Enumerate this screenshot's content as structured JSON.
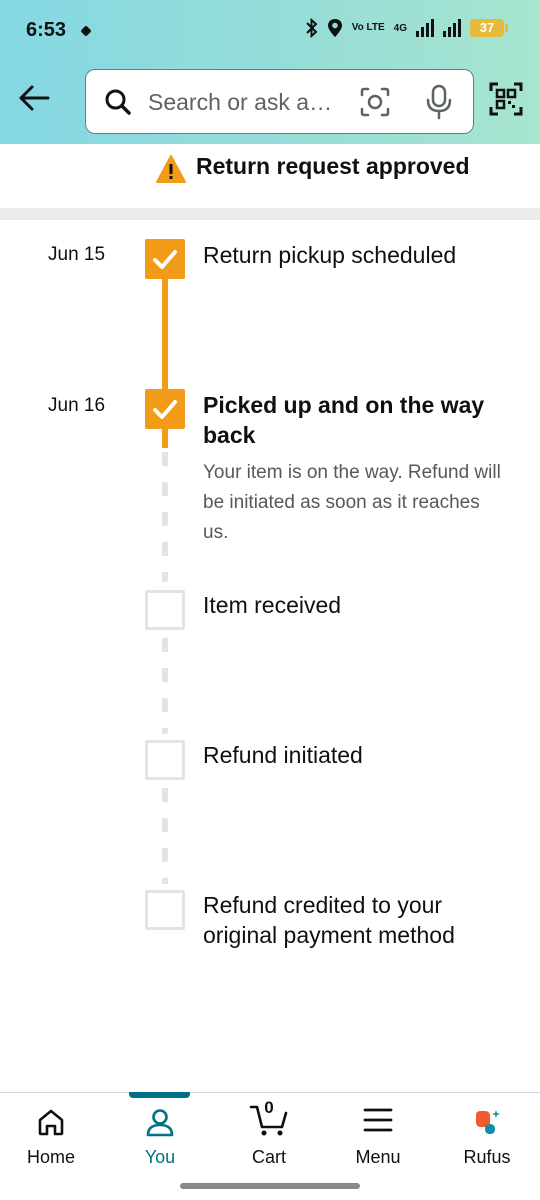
{
  "status_bar": {
    "time": "6:53",
    "volte": "Vo LTE",
    "network": "4G",
    "battery": "37"
  },
  "search": {
    "placeholder": "Search or ask a…"
  },
  "banner": {
    "text": "Return request approved"
  },
  "timeline": [
    {
      "date": "Jun 15",
      "title": "Return pickup scheduled",
      "done": true
    },
    {
      "date": "Jun 16",
      "title": "Picked up and on the way back",
      "done": true,
      "description": "Your item is on the way. Refund will be initiated as soon as it reaches us."
    },
    {
      "date": "",
      "title": "Item received",
      "done": false
    },
    {
      "date": "",
      "title": "Refund initiated",
      "done": false
    },
    {
      "date": "",
      "title": "Refund credited to your original payment method",
      "done": false
    }
  ],
  "colors": {
    "accent": "#f29b18",
    "active_nav": "#007185",
    "pending": "#e3e3e3"
  },
  "bottom_nav": {
    "home": "Home",
    "you": "You",
    "cart": "Cart",
    "cart_count": "0",
    "menu": "Menu",
    "rufus": "Rufus",
    "active": "you"
  }
}
